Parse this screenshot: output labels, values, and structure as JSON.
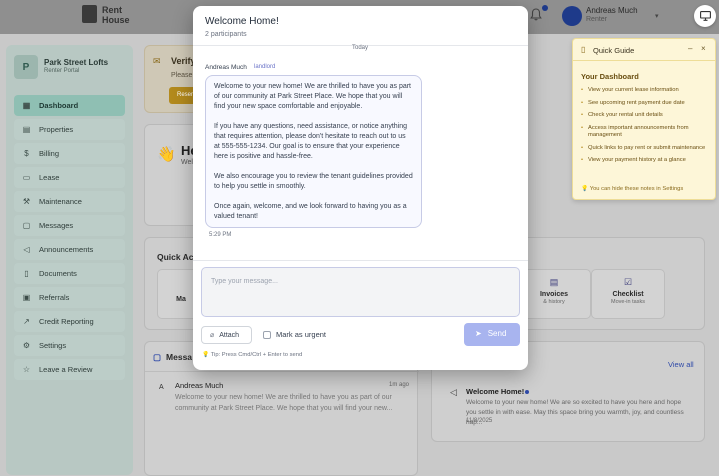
{
  "topbar": {
    "logo_line1": "Rent",
    "logo_line2": "House",
    "user_name": "Andreas Much",
    "user_role": "Renter"
  },
  "sidebar": {
    "property_initial": "P",
    "property_name": "Park Street Lofts",
    "property_sub": "Renter Portal",
    "items": [
      {
        "label": "Dashboard",
        "icon": "grid-icon"
      },
      {
        "label": "Properties",
        "icon": "building-icon"
      },
      {
        "label": "Billing",
        "icon": "dollar-icon"
      },
      {
        "label": "Lease",
        "icon": "document-icon"
      },
      {
        "label": "Maintenance",
        "icon": "wrench-icon"
      },
      {
        "label": "Messages",
        "icon": "chat-icon"
      },
      {
        "label": "Announcements",
        "icon": "megaphone-icon"
      },
      {
        "label": "Documents",
        "icon": "file-icon"
      },
      {
        "label": "Referrals",
        "icon": "gift-icon"
      },
      {
        "label": "Credit Reporting",
        "icon": "trend-icon"
      },
      {
        "label": "Settings",
        "icon": "gear-icon"
      },
      {
        "label": "Leave a Review",
        "icon": "star-icon"
      }
    ]
  },
  "verify": {
    "title": "Verify",
    "sub": "Please",
    "button": "Resen"
  },
  "hello": {
    "title": "He",
    "sub": "Wel"
  },
  "quick_actions": {
    "title": "Quick Act",
    "left_label": "Ma",
    "tiles": [
      {
        "label": "Invoices",
        "sub": "& history"
      },
      {
        "label": "Checklist",
        "sub": "Move-in tasks"
      }
    ]
  },
  "messages_card": {
    "title": "Messa",
    "avatar": "A",
    "from": "Andreas Much",
    "time": "1m ago",
    "preview": "Welcome to your new home! We are thrilled to have you as part of our community at Park Street Place. We hope that you will find your new..."
  },
  "announcements_card": {
    "view_all": "View all",
    "title": "Welcome Home!",
    "text": "Welcome to your new home! We are so excited to have you here and hope you settle in with ease. May this space bring you warmth, joy, and countless hap...",
    "date": "11/8/2025"
  },
  "guide": {
    "title": "Quick Guide",
    "minimize": "–",
    "close": "×",
    "subtitle": "Your Dashboard",
    "items": [
      "View your current lease information",
      "See upcoming rent payment due date",
      "Check your rental unit details",
      "Access important announcements from management",
      "Quick links to pay rent or submit maintenance",
      "View your payment history at a glance"
    ],
    "tip": "You can hide these notes in Settings"
  },
  "modal": {
    "title": "Welcome Home!",
    "participants": "2 participants",
    "day_label": "Today",
    "sender": "Andreas Much",
    "sender_role": "landlord",
    "paragraphs": [
      "Welcome to your new home! We are thrilled to have you as part of our community at Park Street Place. We hope that you will find your new space comfortable and enjoyable.",
      "If you have any questions, need assistance, or notice anything that requires attention, please don't hesitate to reach out to us at 555-555-1234. Our goal is to ensure that your experience here is positive and hassle-free.",
      "We also encourage you to review the tenant guidelines provided to help you settle in smoothly.",
      "Once again, welcome, and we look forward to having you as a valued tenant!"
    ],
    "time": "5:29 PM",
    "input_placeholder": "Type your message...",
    "attach_label": "Attach",
    "urgent_label": "Mark as urgent",
    "send_label": "Send",
    "tip": "Tip: Press Cmd/Ctrl + Enter to send"
  }
}
